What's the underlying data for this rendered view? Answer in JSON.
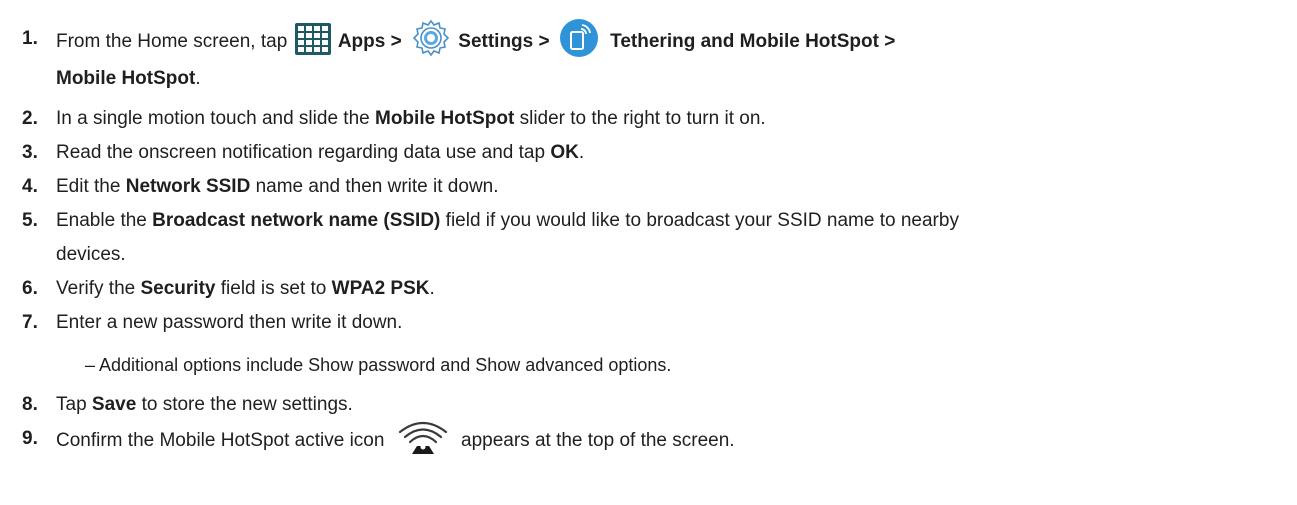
{
  "steps": [
    {
      "num": "1.",
      "t1": "From the Home screen, tap",
      "apps": "Apps >",
      "settings": "Settings >",
      "tethering": "Tethering and Mobile HotSpot >",
      "hotspot": "Mobile HotSpot",
      "end": "."
    },
    {
      "num": "2.",
      "t1": "In a single motion touch and slide the",
      "b1": "Mobile HotSpot",
      "t2": "slider to the right to turn it on."
    },
    {
      "num": "3.",
      "t1": "Read the onscreen notification regarding data use and tap",
      "b1": "OK",
      "t2": "."
    },
    {
      "num": "4.",
      "t1": "Edit the",
      "b1": "Network SSID",
      "t2": "name and then write it down."
    },
    {
      "num": "5.",
      "t1": "Enable the",
      "b1": "Broadcast network name (SSID)",
      "t2": "field if you would like to broadcast your SSID name to nearby",
      "t3": "devices."
    },
    {
      "num": "6.",
      "t1": "Verify the",
      "b1": "Security",
      "t2": "field is set to",
      "b2": "WPA2 PSK",
      "t3": "."
    },
    {
      "num": "7.",
      "t1": "Enter a new password then write it down.",
      "sub": "– Additional options include Show password and Show advanced options."
    },
    {
      "num": "8.",
      "t1": "Tap",
      "b1": "Save",
      "t2": "to store the new settings."
    },
    {
      "num": "9.",
      "t1": "Confirm the Mobile HotSpot active icon",
      "t2": "appears at the top of the screen."
    }
  ],
  "icons": {
    "apps": "apps-grid-icon",
    "settings": "settings-gear-icon",
    "tethering": "tethering-phone-icon",
    "hotspot": "mobile-hotspot-icon"
  },
  "colors": {
    "text": "#1f1f1f",
    "apps_icon": "#1d5a63",
    "settings_icon": "#4a90c8",
    "tether_icon": "#2f93d8"
  }
}
